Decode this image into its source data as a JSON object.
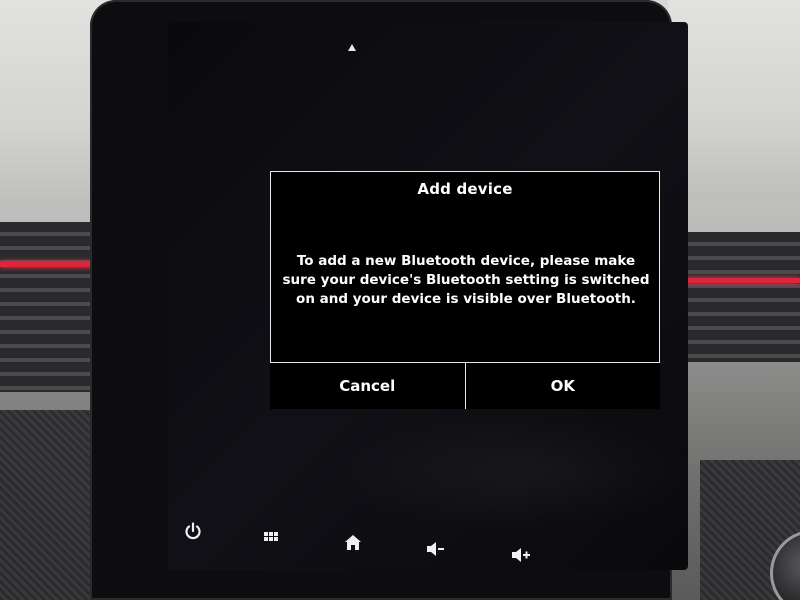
{
  "dialog": {
    "title": "Add device",
    "message": "To add a new Bluetooth device, please make sure your device's Bluetooth setting is switched on and your device is visible over Bluetooth.",
    "cancel_label": "Cancel",
    "ok_label": "OK"
  },
  "bottom_bar": {
    "icons": [
      "power-icon",
      "apps-grid-icon",
      "home-icon",
      "volume-down-icon",
      "volume-up-icon"
    ]
  },
  "colors": {
    "dialog_border": "#e8e8e8",
    "screen_background": "#0a0a0e",
    "accent_red": "#e0253a"
  }
}
